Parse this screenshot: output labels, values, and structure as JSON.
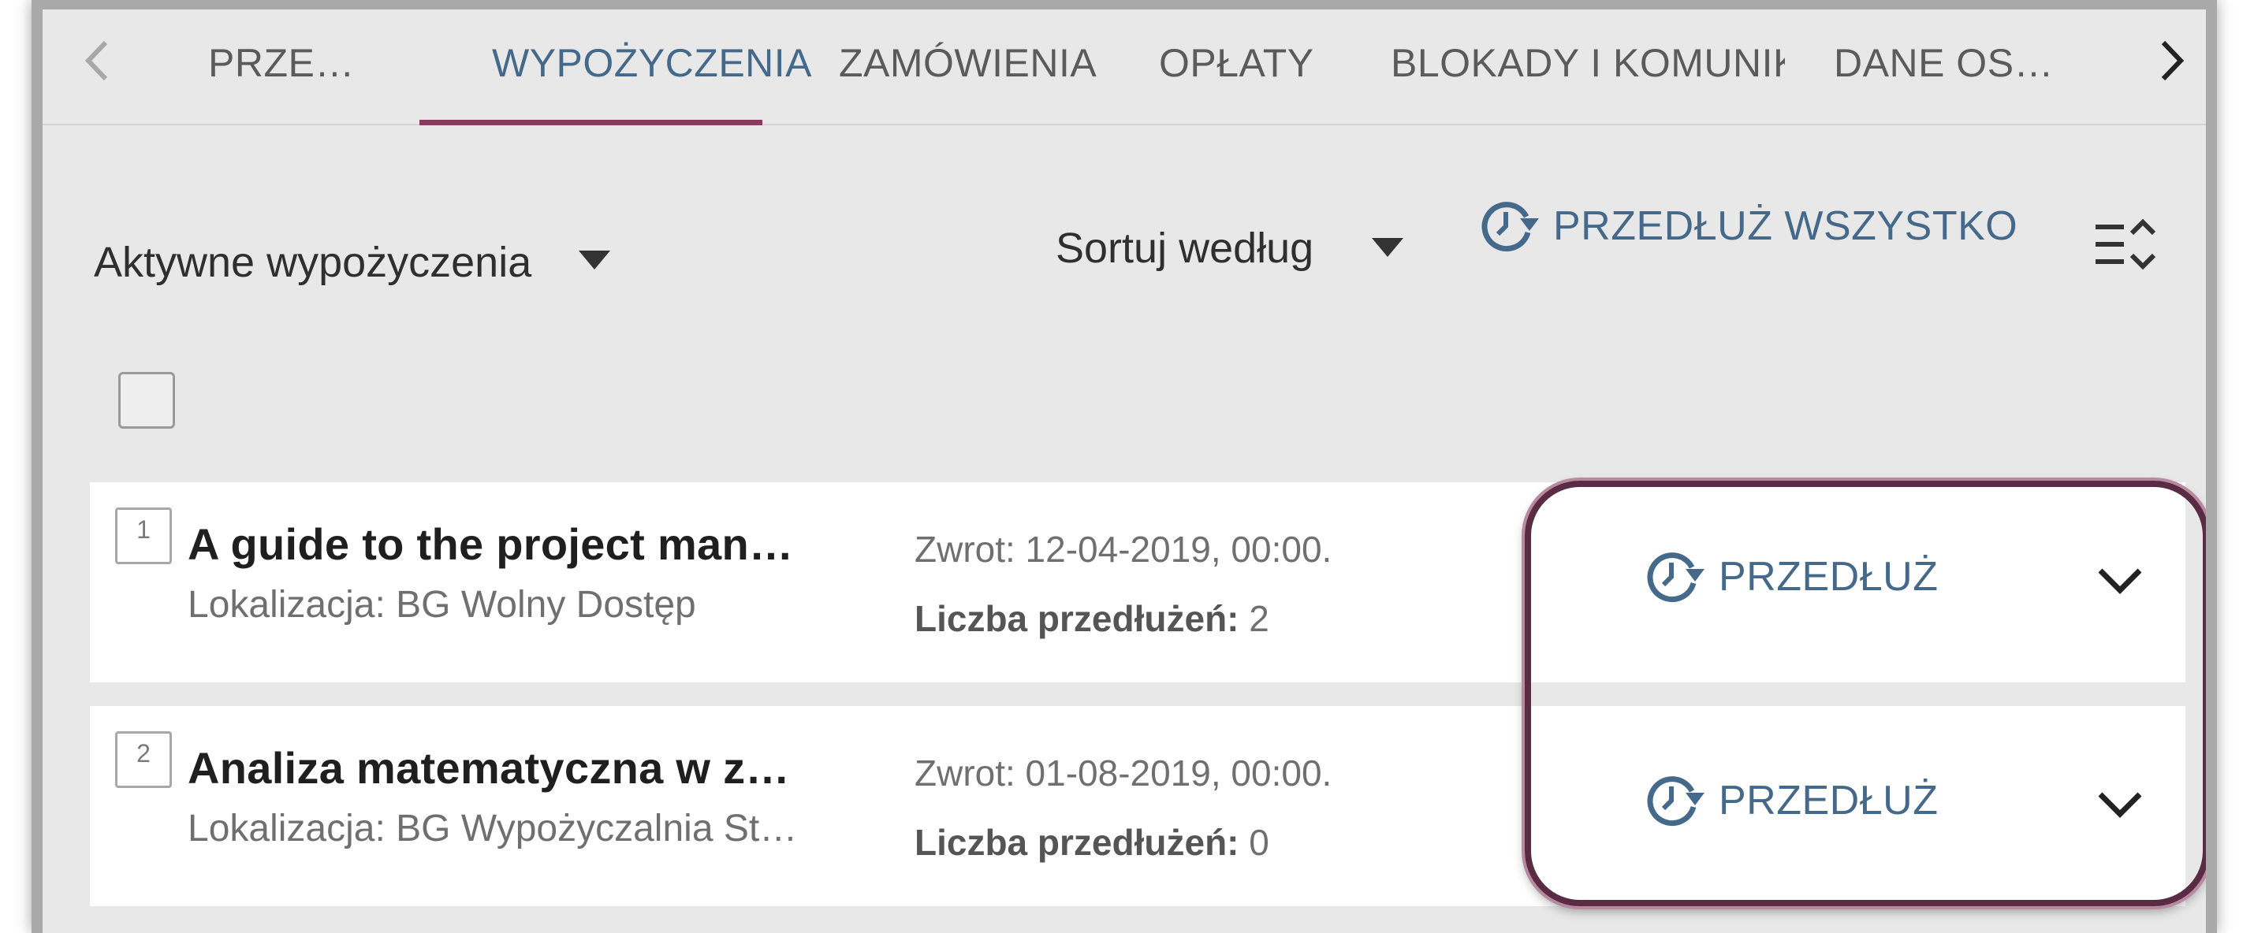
{
  "tabs": [
    {
      "label": "PRZE…"
    },
    {
      "label": "WYPOŻYCZENIA"
    },
    {
      "label": "ZAMÓWIENIA"
    },
    {
      "label": "OPŁATY"
    },
    {
      "label": "BLOKADY I KOMUNIKA"
    },
    {
      "label": "DANE OS…"
    }
  ],
  "filter": {
    "selected": "Aktywne wypożyczenia",
    "sort_label": "Sortuj według"
  },
  "renew_all_label": "PRZEDŁUŻ WSZYSTKO",
  "loans": [
    {
      "number": "1",
      "title": "A guide to the project man…",
      "location": "Lokalizacja: BG Wolny Dostęp",
      "return": "Zwrot: 12-04-2019, 00:00.",
      "renewals_label": "Liczba przedłużeń:",
      "renewals": "2",
      "renew_label": "PRZEDŁUŻ"
    },
    {
      "number": "2",
      "title": "Analiza matematyczna w z…",
      "location": "Lokalizacja: BG Wypożyczalnia St…",
      "return": "Zwrot: 01-08-2019, 00:00.",
      "renewals_label": "Liczba przedłużeń:",
      "renewals": "0",
      "renew_label": "PRZEDŁUŻ"
    }
  ],
  "colors": {
    "accent": "#44698a",
    "active_tab_underline": "#8a3a5f",
    "highlight_border": "#5a2c44"
  }
}
